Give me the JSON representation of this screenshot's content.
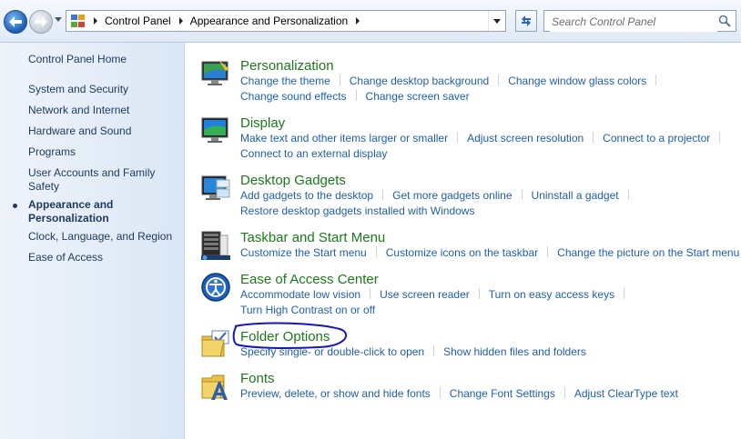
{
  "address": {
    "crumbs": [
      "Control Panel",
      "Appearance and Personalization"
    ],
    "search_placeholder": "Search Control Panel"
  },
  "sidebar": {
    "home": "Control Panel Home",
    "items": [
      "System and Security",
      "Network and Internet",
      "Hardware and Sound",
      "Programs",
      "User Accounts and Family Safety",
      "Appearance and Personalization",
      "Clock, Language, and Region",
      "Ease of Access"
    ],
    "active_index": 5
  },
  "categories": [
    {
      "title": "Personalization",
      "row1": [
        "Change the theme",
        "Change desktop background",
        "Change window glass colors"
      ],
      "row2": [
        "Change sound effects",
        "Change screen saver"
      ]
    },
    {
      "title": "Display",
      "row1": [
        "Make text and other items larger or smaller",
        "Adjust screen resolution",
        "Connect to a projector"
      ],
      "row2": [
        "Connect to an external display"
      ]
    },
    {
      "title": "Desktop Gadgets",
      "row1": [
        "Add gadgets to the desktop",
        "Get more gadgets online",
        "Uninstall a gadget"
      ],
      "row2": [
        "Restore desktop gadgets installed with Windows"
      ]
    },
    {
      "title": "Taskbar and Start Menu",
      "row1": [
        "Customize the Start menu",
        "Customize icons on the taskbar",
        "Change the picture on the Start menu"
      ],
      "row2": []
    },
    {
      "title": "Ease of Access Center",
      "row1": [
        "Accommodate low vision",
        "Use screen reader",
        "Turn on easy access keys"
      ],
      "row2": [
        "Turn High Contrast on or off"
      ]
    },
    {
      "title": "Folder Options",
      "row1": [
        "Specify single- or double-click to open",
        "Show hidden files and folders"
      ],
      "row2": []
    },
    {
      "title": "Fonts",
      "row1": [
        "Preview, delete, or show and hide fonts",
        "Change Font Settings",
        "Adjust ClearType text"
      ],
      "row2": []
    }
  ],
  "colors": {
    "link": "#1e5fb0",
    "category_title": "#1a7a1a",
    "sidebar_text": "#1e395b",
    "annotation_oval": "#1515c8"
  }
}
